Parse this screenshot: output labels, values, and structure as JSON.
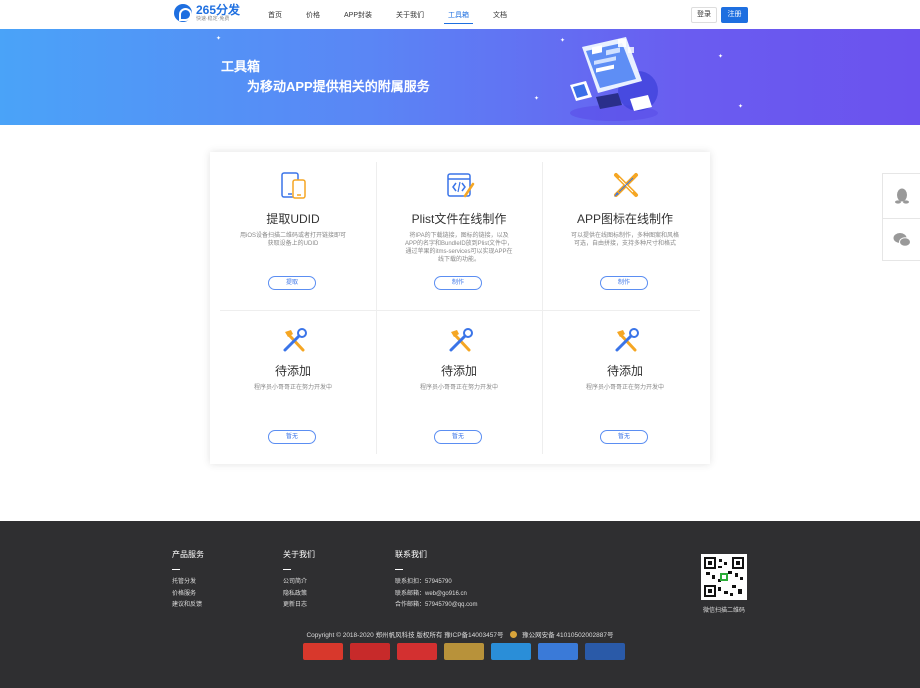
{
  "header": {
    "logo_title": "265分发",
    "logo_sub": "快速·稳定·免费",
    "nav": [
      {
        "label": "首页",
        "active": false
      },
      {
        "label": "价格",
        "active": false
      },
      {
        "label": "APP封装",
        "active": false
      },
      {
        "label": "关于我们",
        "active": false
      },
      {
        "label": "工具箱",
        "active": true
      },
      {
        "label": "文档",
        "active": false
      }
    ],
    "login": "登录",
    "register": "注册"
  },
  "banner": {
    "title": "工具箱",
    "subtitle": "为移动APP提供相关的附属服务"
  },
  "tools": [
    {
      "icon": "device-icon",
      "title": "提取UDID",
      "desc": "用iOS设备扫描二维码或者打开链接即可获取设备上的UDID",
      "button": "提取"
    },
    {
      "icon": "code-icon",
      "title": "Plist文件在线制作",
      "desc": "将IPA的下载链接，图标的链接，以及APP的名字和BundleID放到Plist文件中，通过苹果的itms-services可以实现APP在线下载的功能。",
      "button": "制作"
    },
    {
      "icon": "pencil-ruler-icon",
      "title": "APP图标在线制作",
      "desc": "可以提供在线图标制作，多种图案和风格可选，自由拼接，支持多种尺寸和格式",
      "button": "制作"
    },
    {
      "icon": "tools-icon",
      "title": "待添加",
      "desc": "程序员小哥哥正在努力开发中",
      "button": "暂无"
    },
    {
      "icon": "tools-icon",
      "title": "待添加",
      "desc": "程序员小哥哥正在努力开发中",
      "button": "暂无"
    },
    {
      "icon": "tools-icon",
      "title": "待添加",
      "desc": "程序员小哥哥正在努力开发中",
      "button": "暂无"
    }
  ],
  "colors": {
    "accent": "#1e6fe0",
    "icon_orange": "#f5a623",
    "icon_blue": "#3a74e8",
    "footer_bg": "#2f2f31"
  },
  "footer": {
    "columns": [
      {
        "title": "产品服务",
        "items": [
          "托管分发",
          "价格服务",
          "建议和反馈"
        ]
      },
      {
        "title": "关于我们",
        "items": [
          "公司简介",
          "隐私政策",
          "更新日志"
        ]
      },
      {
        "title": "联系我们",
        "items": [
          "联系扣扣：57945790",
          "联系邮箱：web@go916.cn",
          "合作邮箱：57945790@qq.com"
        ]
      }
    ],
    "qr_label": "微信扫描二维码",
    "copyright": "Copyright © 2018-2020 郑州帆风科技 版权所有 豫ICP备14003457号",
    "police": "豫公网安备 41010502002887号",
    "badges": [
      {
        "name": "trust-badge-1",
        "color": "#d8382c"
      },
      {
        "name": "trust-badge-2",
        "color": "#c72a2a"
      },
      {
        "name": "trust-badge-3",
        "color": "#d33030"
      },
      {
        "name": "trust-badge-4",
        "color": "#b8923a"
      },
      {
        "name": "trust-badge-5",
        "color": "#2a8ed8"
      },
      {
        "name": "trust-badge-6",
        "color": "#3a7ad8"
      },
      {
        "name": "trust-badge-7",
        "color": "#2a5aa8"
      }
    ]
  }
}
